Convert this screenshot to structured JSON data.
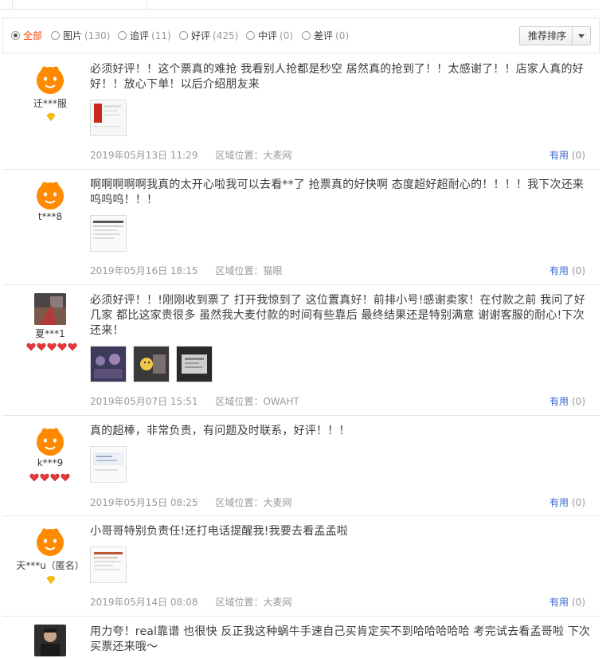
{
  "filters": [
    {
      "label": "全部",
      "count": "",
      "checked": true
    },
    {
      "label": "图片",
      "count": "(130)",
      "checked": false
    },
    {
      "label": "追评",
      "count": "(11)",
      "checked": false
    },
    {
      "label": "好评",
      "count": "(425)",
      "checked": false
    },
    {
      "label": "中评",
      "count": "(0)",
      "checked": false
    },
    {
      "label": "差评",
      "count": "(0)",
      "checked": false
    }
  ],
  "sort": {
    "label": "推荐排序"
  },
  "reviews": [
    {
      "user": "迁***服",
      "avatar": "taobao-default-avatar",
      "badge": "diamond-yellow-1",
      "content": "必须好评！！这个票真的难抢 我看别人抢都是秒空 居然真的抢到了！！太感谢了！！店家人真的好好！！放心下单！以后介绍朋友来",
      "date": "2019年05月13日 11:29",
      "location": "区域位置：大麦网",
      "helpful_label": "有用",
      "helpful_count": "(0)"
    },
    {
      "user": "t***8",
      "avatar": "taobao-default-avatar",
      "badge": "",
      "content": "啊啊啊啊啊我真的太开心啦我可以去看**了 抢票真的好快啊 态度超好超耐心的！！！！我下次还来呜呜呜！！！",
      "date": "2019年05月16日 18:15",
      "location": "区域位置：猫眼",
      "helpful_label": "有用",
      "helpful_count": "(0)"
    },
    {
      "user": "夏***1",
      "avatar": "photo-avatar",
      "badge": "heart-red-5",
      "content": "必须好评！！!刚刚收到票了 打开我惊到了 这位置真好！前排小号!感谢卖家！在付款之前 我问了好几家 都比这家贵很多 虽然我大麦付款的时间有些靠后 最终结果还是特别满意 谢谢客服的耐心!下次还来！",
      "date": "2019年05月07日 15:51",
      "location": "区域位置：OWAHT",
      "helpful_label": "有用",
      "helpful_count": "(0)"
    },
    {
      "user": "k***9",
      "avatar": "taobao-default-avatar",
      "badge": "heart-red-4",
      "content": "真的超棒，非常负责，有问题及时联系，好评！！！",
      "date": "2019年05月15日 08:25",
      "location": "区域位置：大麦网",
      "helpful_label": "有用",
      "helpful_count": "(0)"
    },
    {
      "user": "天***u（匿名）",
      "avatar": "taobao-default-avatar",
      "badge": "diamond-yellow-1",
      "content": "小哥哥特别负责任!还打电话提醒我!我要去看孟孟啦",
      "date": "2019年05月14日 08:08",
      "location": "区域位置：大麦网",
      "helpful_label": "有用",
      "helpful_count": "(0)"
    },
    {
      "user": "",
      "avatar": "photo-avatar",
      "badge": "",
      "content": "用力夸！real靠谱 也很快 反正我这种蜗牛手速自己买肯定买不到哈哈哈哈哈 考完试去看孟哥啦 下次买票还来哦～",
      "date": "",
      "location": "",
      "helpful_label": "",
      "helpful_count": ""
    }
  ],
  "colors": {
    "accent_active": "#ff4400",
    "link_blue": "#3366cc",
    "meta_gray": "#999999",
    "avatar_orange": "#ff8a00",
    "heart_red": "#e4393c",
    "diamond_yellow": "#f5c000"
  }
}
